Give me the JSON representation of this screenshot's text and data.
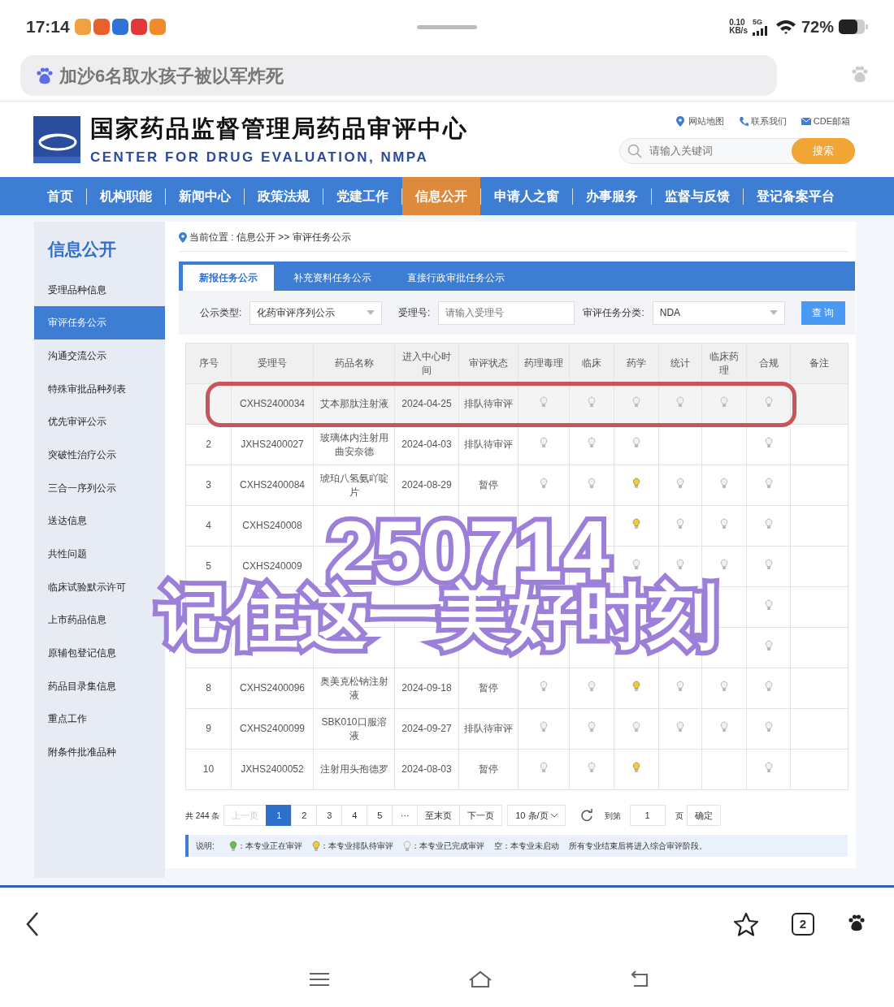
{
  "status_bar": {
    "time": "17:14",
    "speed_value": "0.10",
    "speed_unit": "KB/s",
    "network": "5G",
    "battery": "72%"
  },
  "browser_search": {
    "query": "加沙6名取水孩子被以军炸死"
  },
  "site": {
    "title": "国家药品监督管理局药品审评中心",
    "subtitle": "CENTER FOR DRUG EVALUATION, NMPA",
    "links": [
      {
        "kind": "pin",
        "label": "网站地图"
      },
      {
        "kind": "phone",
        "label": "联系我们"
      },
      {
        "kind": "mail",
        "label": "CDE邮箱"
      }
    ],
    "search": {
      "placeholder": "请输入关键词",
      "button": "搜索"
    }
  },
  "nav": [
    {
      "label": "首页",
      "selected": false
    },
    {
      "label": "机构职能",
      "selected": false
    },
    {
      "label": "新闻中心",
      "selected": false
    },
    {
      "label": "政策法规",
      "selected": false
    },
    {
      "label": "党建工作",
      "selected": false
    },
    {
      "label": "信息公开",
      "selected": true
    },
    {
      "label": "申请人之窗",
      "selected": false
    },
    {
      "label": "办事服务",
      "selected": false
    },
    {
      "label": "监督与反馈",
      "selected": false
    },
    {
      "label": "登记备案平台",
      "selected": false
    }
  ],
  "sidebar": {
    "title": "信息公开",
    "items": [
      {
        "label": "受理品种信息",
        "selected": false
      },
      {
        "label": "审评任务公示",
        "selected": true
      },
      {
        "label": "沟通交流公示",
        "selected": false
      },
      {
        "label": "特殊审批品种列表",
        "selected": false
      },
      {
        "label": "优先审评公示",
        "selected": false
      },
      {
        "label": "突破性治疗公示",
        "selected": false
      },
      {
        "label": "三合一序列公示",
        "selected": false
      },
      {
        "label": "送达信息",
        "selected": false
      },
      {
        "label": "共性问题",
        "selected": false
      },
      {
        "label": "临床试验默示许可",
        "selected": false
      },
      {
        "label": "上市药品信息",
        "selected": false
      },
      {
        "label": "原辅包登记信息",
        "selected": false
      },
      {
        "label": "药品目录集信息",
        "selected": false
      },
      {
        "label": "重点工作",
        "selected": false
      },
      {
        "label": "附条件批准品种",
        "selected": false
      }
    ]
  },
  "breadcrumb": "当前位置 : 信息公开 >> 审评任务公示",
  "tabs": [
    {
      "label": "新报任务公示",
      "selected": true
    },
    {
      "label": "补充资料任务公示",
      "selected": false
    },
    {
      "label": "直接行政审批任务公示",
      "selected": false
    }
  ],
  "filters": [
    {
      "kind": "select",
      "label": "公示类型:",
      "value": "化药审评序列公示"
    },
    {
      "kind": "input",
      "label": "受理号:",
      "placeholder": "请输入受理号"
    },
    {
      "kind": "select",
      "label": "审评任务分类:",
      "value": "NDA"
    }
  ],
  "query_button": "查 询",
  "table": {
    "columns": [
      "序号",
      "受理号",
      "药品名称",
      "进入中心时间",
      "审评状态",
      "药理毒理",
      "临床",
      "药学",
      "统计",
      "临床药理",
      "合规",
      "备注"
    ],
    "rows": [
      {
        "highlighted": true,
        "cells": [
          "",
          "CXHS2400034",
          "艾本那肽注射液",
          "2024-04-25",
          "排队待审评"
        ],
        "reviews": [
          {
            "kind": "done"
          },
          {
            "kind": "done"
          },
          {
            "kind": "done"
          },
          {
            "kind": "done"
          },
          {
            "kind": "done"
          },
          {
            "kind": "done"
          }
        ]
      },
      {
        "highlighted": false,
        "cells": [
          "2",
          "JXHS2400027",
          "玻璃体内注射用曲安奈德",
          "2024-04-03",
          "排队待审评"
        ],
        "reviews": [
          {
            "kind": "done"
          },
          {
            "kind": "done"
          },
          {
            "kind": "done"
          },
          {
            "kind": "empty"
          },
          {
            "kind": "empty"
          },
          {
            "kind": "done"
          }
        ]
      },
      {
        "highlighted": false,
        "cells": [
          "3",
          "CXHS2400084",
          "琥珀八氢氨吖啶片",
          "2024-08-29",
          "暂停"
        ],
        "reviews": [
          {
            "kind": "done"
          },
          {
            "kind": "done"
          },
          {
            "kind": "queue"
          },
          {
            "kind": "done"
          },
          {
            "kind": "done"
          },
          {
            "kind": "done"
          }
        ]
      },
      {
        "highlighted": false,
        "cells": [
          "4",
          "CXHS240008",
          "",
          "",
          ""
        ],
        "reviews": [
          {
            "kind": "empty"
          },
          {
            "kind": "empty"
          },
          {
            "kind": "queue"
          },
          {
            "kind": "done"
          },
          {
            "kind": "done"
          },
          {
            "kind": "done"
          }
        ]
      },
      {
        "highlighted": false,
        "cells": [
          "5",
          "CXHS240009",
          "",
          "",
          ""
        ],
        "reviews": [
          {
            "kind": "empty"
          },
          {
            "kind": "empty"
          },
          {
            "kind": "done"
          },
          {
            "kind": "done"
          },
          {
            "kind": "done"
          },
          {
            "kind": "done"
          }
        ]
      },
      {
        "highlighted": false,
        "cells": [
          "",
          "",
          "",
          "",
          ""
        ],
        "reviews": [
          {
            "kind": "empty"
          },
          {
            "kind": "empty"
          },
          {
            "kind": "empty"
          },
          {
            "kind": "empty"
          },
          {
            "kind": "empty"
          },
          {
            "kind": "done"
          }
        ]
      },
      {
        "highlighted": false,
        "cells": [
          "",
          "",
          "",
          "",
          ""
        ],
        "reviews": [
          {
            "kind": "empty"
          },
          {
            "kind": "empty"
          },
          {
            "kind": "empty"
          },
          {
            "kind": "empty"
          },
          {
            "kind": "empty"
          },
          {
            "kind": "done"
          }
        ]
      },
      {
        "highlighted": false,
        "cells": [
          "8",
          "CXHS2400096",
          "奥美克松钠注射液",
          "2024-09-18",
          "暂停"
        ],
        "reviews": [
          {
            "kind": "done"
          },
          {
            "kind": "done"
          },
          {
            "kind": "queue"
          },
          {
            "kind": "done"
          },
          {
            "kind": "done"
          },
          {
            "kind": "done"
          }
        ]
      },
      {
        "highlighted": false,
        "cells": [
          "9",
          "CXHS2400099",
          "SBK010口服溶液",
          "2024-09-27",
          "排队待审评"
        ],
        "reviews": [
          {
            "kind": "done"
          },
          {
            "kind": "done"
          },
          {
            "kind": "done"
          },
          {
            "kind": "done"
          },
          {
            "kind": "done"
          },
          {
            "kind": "done"
          }
        ]
      },
      {
        "highlighted": false,
        "cells": [
          "10",
          "JXHS2400052",
          "注射用头孢德罗",
          "2024-08-03",
          "暂停"
        ],
        "reviews": [
          {
            "kind": "done"
          },
          {
            "kind": "done"
          },
          {
            "kind": "queue"
          },
          {
            "kind": "empty"
          },
          {
            "kind": "empty"
          },
          {
            "kind": "done"
          }
        ]
      }
    ]
  },
  "pagination": {
    "total": "共 244 条",
    "prev": {
      "label": "上一页",
      "disabled": true
    },
    "pages": [
      {
        "label": "1",
        "selected": true
      },
      {
        "label": "2",
        "selected": false
      },
      {
        "label": "3",
        "selected": false
      },
      {
        "label": "4",
        "selected": false
      },
      {
        "label": "5",
        "selected": false
      },
      {
        "label": "···",
        "selected": false
      }
    ],
    "last": "至末页",
    "next": "下一页",
    "page_size": "10 条/页",
    "goto": "到第",
    "page_value": "1",
    "page_unit": "页",
    "confirm": "确定"
  },
  "legend": {
    "label": "说明:",
    "items": [
      {
        "kind": "active",
        "text": "：本专业正在审评"
      },
      {
        "kind": "queue",
        "text": "：本专业排队待审评"
      },
      {
        "kind": "done",
        "text": "：本专业已完成审评"
      }
    ],
    "notes": [
      "空：本专业未启动",
      "所有专业结束后将进入综合审评阶段。"
    ]
  },
  "overlay": {
    "lines": [
      "250714",
      "记住这一美好时刻"
    ]
  },
  "bottom_bar": {
    "tab_count": "2"
  }
}
